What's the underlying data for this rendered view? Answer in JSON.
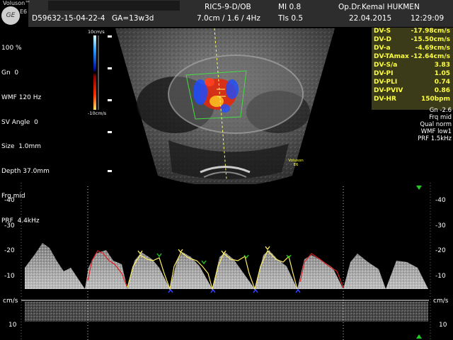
{
  "header": {
    "brand": "Voluson™",
    "model": "E6",
    "logo_text": "GE",
    "patient_id": "D59632-15-04-22-4",
    "gestational_age": "GA=13w3d",
    "probe": "RIC5-9-D/OB",
    "depth_freq": "7.0cm / 1.6 / 4Hz",
    "mi": "MI  0.8",
    "tis": "TIs  0.5",
    "operator": "Op.Dr.Kemal HUKMEN",
    "date": "22.04.2015",
    "time": "12:29:09"
  },
  "left_params": [
    "100 %",
    "Gn  0",
    "WMF 120 Hz",
    "SV Angle  0",
    "Size  1.0mm",
    "Depth 37.0mm",
    "Frq mid",
    "PRF  4.4kHz"
  ],
  "color_bar": {
    "top_label": "10cm/s",
    "bottom_label": "-10cm/s"
  },
  "measurements": [
    {
      "label": "DV-S",
      "value": "-17.98cm/s"
    },
    {
      "label": "DV-D",
      "value": "-15.50cm/s"
    },
    {
      "label": "DV-a",
      "value": "-4.69cm/s"
    },
    {
      "label": "DV-TAmax",
      "value": "-12.64cm/s"
    },
    {
      "label": "DV-S/a",
      "value": "3.83"
    },
    {
      "label": "DV-PI",
      "value": "1.05"
    },
    {
      "label": "DV-PLI",
      "value": "0.74"
    },
    {
      "label": "DV-PVIV",
      "value": "0.86"
    },
    {
      "label": "DV-HR",
      "value": "150bpm"
    }
  ],
  "right_params": [
    "Gn -2.6",
    "Frq mid",
    "Qual norm",
    "WMF low1",
    "PRF  1.5kHz"
  ],
  "image_watermark": {
    "line1": "Voluson",
    "line2": "E6"
  },
  "spectrum": {
    "unit_label": "cm/s",
    "y_ticks": [
      "-40",
      "-30",
      "-20",
      "-10",
      "10"
    ]
  },
  "colors": {
    "header_band": "#2d2d2d",
    "measure_bg": "#3b3b1a",
    "measure_text": "#ffff40",
    "trace_yellow": "#ffee66",
    "trace_red": "#e02020",
    "marker_green": "#22cc22",
    "marker_blue": "#3344ff"
  }
}
